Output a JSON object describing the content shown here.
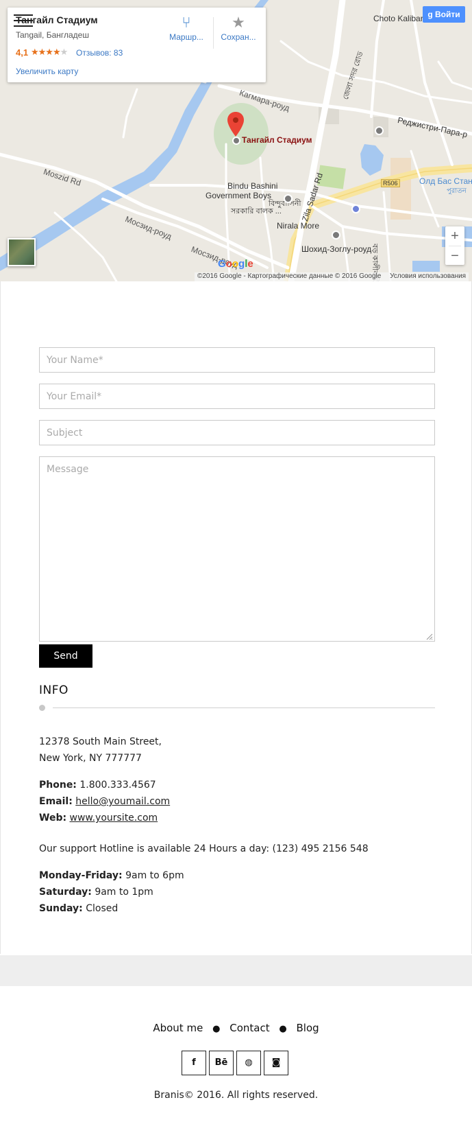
{
  "map": {
    "place_title": "Тангайл Стадиум",
    "place_subtitle": "Tangail, Бангладеш",
    "rating": "4,1",
    "rating_value": 4.1,
    "reviews": "Отзывов: 83",
    "enlarge_link": "Увеличить карту",
    "route_label": "Маршр...",
    "save_label": "Сохран...",
    "login_label": "Войти",
    "zoom_in": "+",
    "zoom_out": "−",
    "footer_copyright": "©2016 Google - Картографические данные © 2016 Google",
    "footer_terms": "Условия использования",
    "labels": {
      "stadium": "Тангайл Стадиум",
      "choto_kalibari": "Choto Kalibari",
      "kagmara": "Кагмара-роуд",
      "registri": "Реджистри-Пара-р",
      "moszid_rd": "Moszid Rd",
      "mosaid_road_1": "Мосзид-роуд",
      "mosaid_road_2": "Мосзид-роуд",
      "bindu_bashini_1": "Bindu Bashini",
      "bindu_bashini_2": "Government Boys",
      "bindu_bashini_3": "সরকারি বালক ...",
      "bindu_bengali": "বিন্দুবাসিনী",
      "zila_sadar": "Zila Sadar Rd",
      "nirala_more": "Nirala More",
      "shokhid": "Шохид-Зоглу-роуд",
      "old_bus": "Олд Бас Стан",
      "old_bus_bn": "পুরাতন",
      "r506": "R506",
      "bengali_road": "জেলা সদর রোড",
      "bengali_road2": "বড় কালীবাড়ি রোড"
    }
  },
  "form": {
    "name_placeholder": "Your Name*",
    "email_placeholder": "Your Email*",
    "subject_placeholder": "Subject",
    "message_placeholder": "Message",
    "send_label": "Send"
  },
  "info": {
    "heading": "INFO",
    "address_line1": "12378 South Main Street,",
    "address_line2": "New York, NY 777777",
    "phone_label": "Phone:",
    "phone_value": "1.800.333.4567",
    "email_label": "Email:",
    "email_value": "hello@youmail.com",
    "web_label": "Web:",
    "web_value": "www.yoursite.com",
    "hotline": "Our support Hotline is available 24 Hours a day: (123) 495 2156 548",
    "hours": [
      {
        "label": "Monday-Friday:",
        "value": "9am to 6pm"
      },
      {
        "label": "Saturday:",
        "value": "9am to 1pm"
      },
      {
        "label": "Sunday:",
        "value": "Closed"
      }
    ]
  },
  "footer": {
    "nav": [
      "About me",
      "Contact",
      "Blog"
    ],
    "social": [
      {
        "icon": "facebook-icon",
        "glyph": "f"
      },
      {
        "icon": "behance-icon",
        "glyph": "Bē"
      },
      {
        "icon": "dribbble-icon",
        "glyph": "◍"
      },
      {
        "icon": "instagram-icon",
        "glyph": "◙"
      }
    ],
    "copyright": "Branis© 2016. All rights reserved."
  },
  "colors": {
    "accent_blue": "#4d90fe",
    "link_blue": "#3a78c4",
    "rating_orange": "#e7711b",
    "send_button": "#000000",
    "gray_band": "#eeeeee"
  }
}
